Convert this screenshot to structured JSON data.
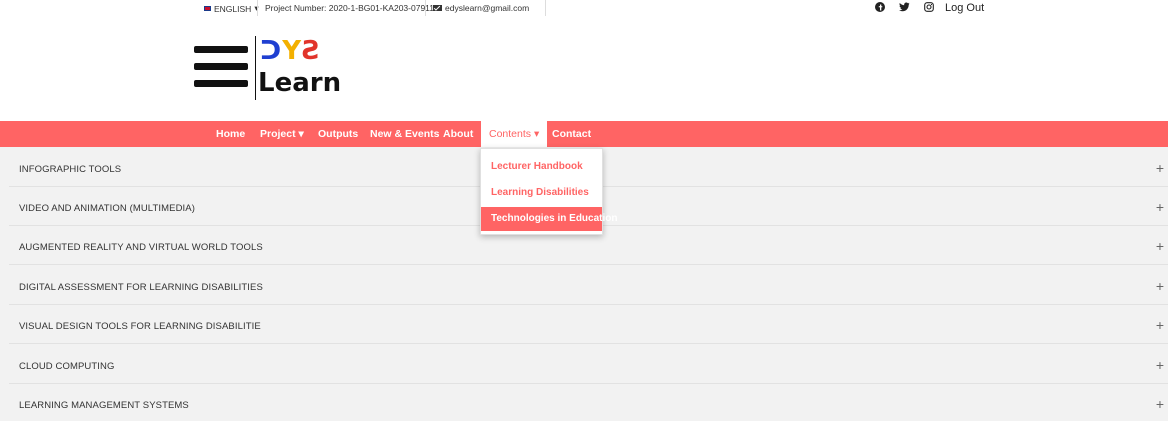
{
  "topbar": {
    "language": "ENGLISH",
    "project_number": "Project Number: 2020-1-BG01-KA203-079118",
    "email": "edyslearn@gmail.com",
    "logout": "Log Out"
  },
  "logo": {
    "line1": "DYS",
    "line2": "Learn",
    "colors": [
      "#1f3fd1",
      "#f3b000",
      "#e1342b"
    ]
  },
  "nav": {
    "items": [
      {
        "label": "Home"
      },
      {
        "label": "Project"
      },
      {
        "label": "Outputs"
      },
      {
        "label": "New & Events"
      },
      {
        "label": "About"
      },
      {
        "label": "Contents"
      },
      {
        "label": "Contact"
      }
    ],
    "caret": "▾"
  },
  "dropdown": {
    "items": [
      {
        "label": "Lecturer Handbook"
      },
      {
        "label": "Learning Disabilities"
      },
      {
        "label": "Technologies in Education"
      }
    ]
  },
  "accordion": {
    "items": [
      {
        "title": "INFOGRAPHIC TOOLS"
      },
      {
        "title": "VIDEO AND ANIMATION (MULTIMEDIA)"
      },
      {
        "title": "AUGMENTED REALITY AND VIRTUAL WORLD TOOLS"
      },
      {
        "title": "DIGITAL ASSESSMENT FOR LEARNING DISABILITIES"
      },
      {
        "title": "VISUAL DESIGN TOOLS FOR LEARNING DISABILITIE"
      },
      {
        "title": "CLOUD COMPUTING"
      },
      {
        "title": "LEARNING MANAGEMENT SYSTEMS"
      }
    ],
    "expand_symbol": "+"
  },
  "colors": {
    "brand": "#ff6464",
    "accordion_bg": "#f2f2f2"
  }
}
